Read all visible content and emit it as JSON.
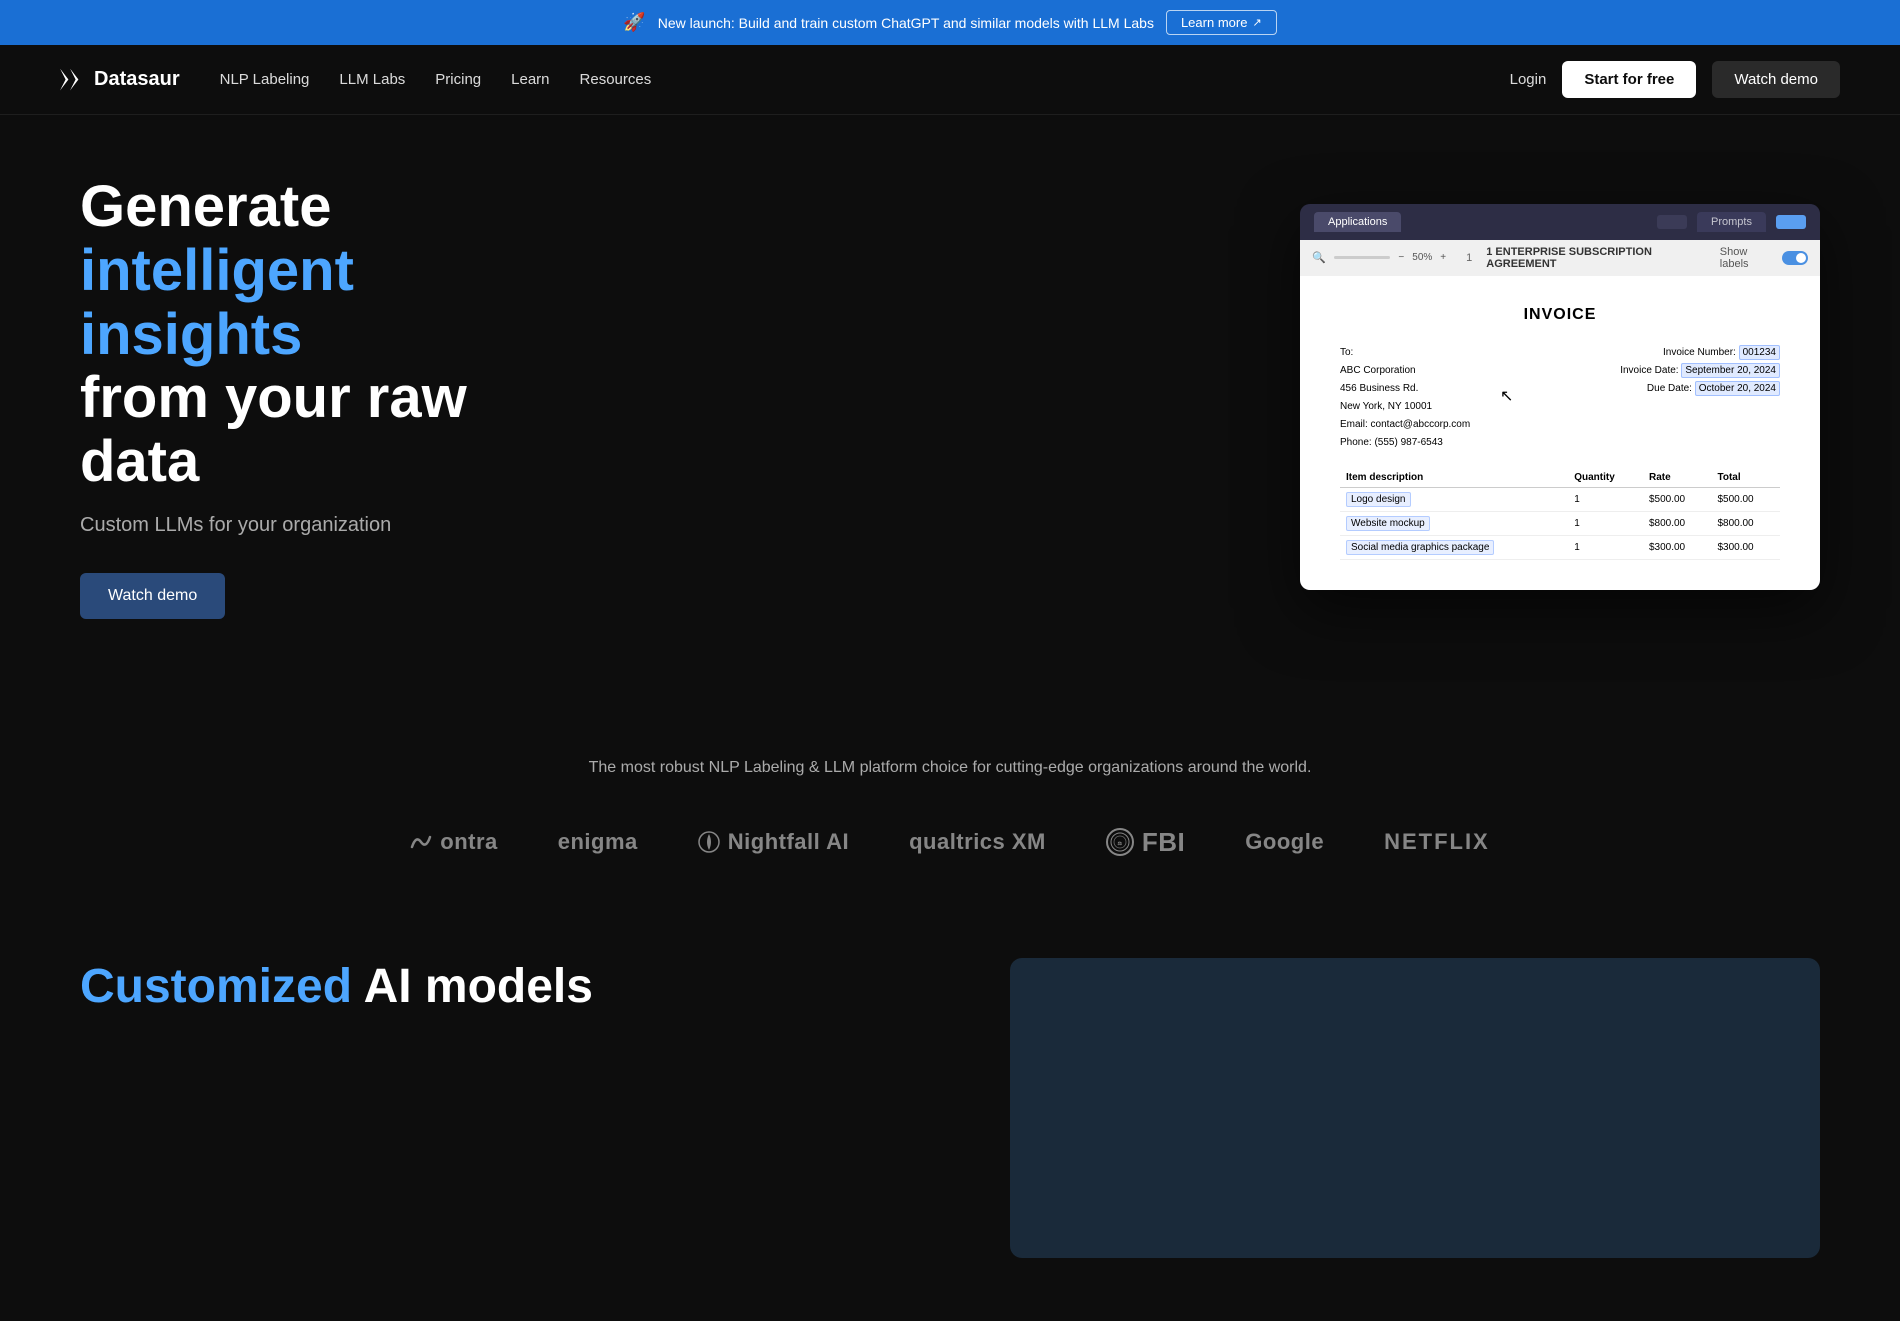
{
  "announcement": {
    "text": "New launch: Build and train custom ChatGPT and similar models with LLM Labs",
    "rocket_icon": "🚀",
    "learn_more_label": "Learn more",
    "learn_more_ext_icon": "↗"
  },
  "nav": {
    "logo_text": "Datasaur",
    "links": [
      {
        "id": "nlp-labeling",
        "label": "NLP Labeling"
      },
      {
        "id": "llm-labs",
        "label": "LLM Labs"
      },
      {
        "id": "pricing",
        "label": "Pricing"
      },
      {
        "id": "learn",
        "label": "Learn"
      },
      {
        "id": "resources",
        "label": "Resources"
      }
    ],
    "login_label": "Login",
    "start_free_label": "Start for free",
    "watch_demo_label": "Watch demo"
  },
  "hero": {
    "title_line1": "Generate",
    "title_line2": "intelligent insights",
    "title_line3": "from your raw data",
    "subtitle": "Custom LLMs for your organization",
    "cta_label": "Watch demo"
  },
  "mock_ui": {
    "tab1": "Applications",
    "tab2": "Prompts",
    "breadcrumb": "1    ENTERPRISE SUBSCRIPTION AGREEMENT",
    "show_labels": "Show labels",
    "zoom_pct": "50%",
    "doc_title": "INVOICE",
    "doc_to_label": "To:",
    "doc_company": "ABC Corporation",
    "doc_address1": "456 Business Rd.",
    "doc_city": "New York, NY 10001",
    "doc_email": "Email: contact@abccorp.com",
    "doc_phone": "Phone: (555) 987-6543",
    "invoice_number_label": "Invoice Number:",
    "invoice_number": "001234",
    "invoice_date_label": "Invoice Date:",
    "invoice_date": "September 20, 2024",
    "due_date_label": "Due Date:",
    "due_date": "October 20, 2024",
    "table_headers": [
      "Item description",
      "Quantity",
      "Rate",
      "Total"
    ],
    "table_rows": [
      {
        "item": "Logo design",
        "qty": "1",
        "rate": "$500.00",
        "total": "$500.00"
      },
      {
        "item": "Website mockup",
        "qty": "1",
        "rate": "$800.00",
        "total": "$800.00"
      },
      {
        "item": "Social media graphics package",
        "qty": "1",
        "rate": "$300.00",
        "total": "$300.00"
      }
    ]
  },
  "trusted": {
    "tagline": "The most robust NLP Labeling & LLM platform choice for cutting-edge organizations around the world.",
    "logos": [
      {
        "id": "ontra",
        "name": "ontra",
        "display": "ontra"
      },
      {
        "id": "enigma",
        "name": "enigma",
        "display": "enigma"
      },
      {
        "id": "nightfall-ai",
        "name": "Nightfall AI",
        "display": "Nightfall AI"
      },
      {
        "id": "qualtrics",
        "name": "qualtrics",
        "display": "qualtrics XM"
      },
      {
        "id": "fbi",
        "name": "FBI",
        "display": "FBI"
      },
      {
        "id": "google",
        "name": "Google",
        "display": "Google"
      },
      {
        "id": "netflix",
        "name": "NETFLIX",
        "display": "NETFLIX"
      }
    ]
  },
  "customized": {
    "title_highlight": "Customized",
    "title_rest": " AI models"
  },
  "colors": {
    "accent_blue": "#4da6ff",
    "announcement_bg": "#1a6fd4",
    "dark_bg": "#0d0d0d",
    "nav_dark": "#0d0d0d"
  }
}
